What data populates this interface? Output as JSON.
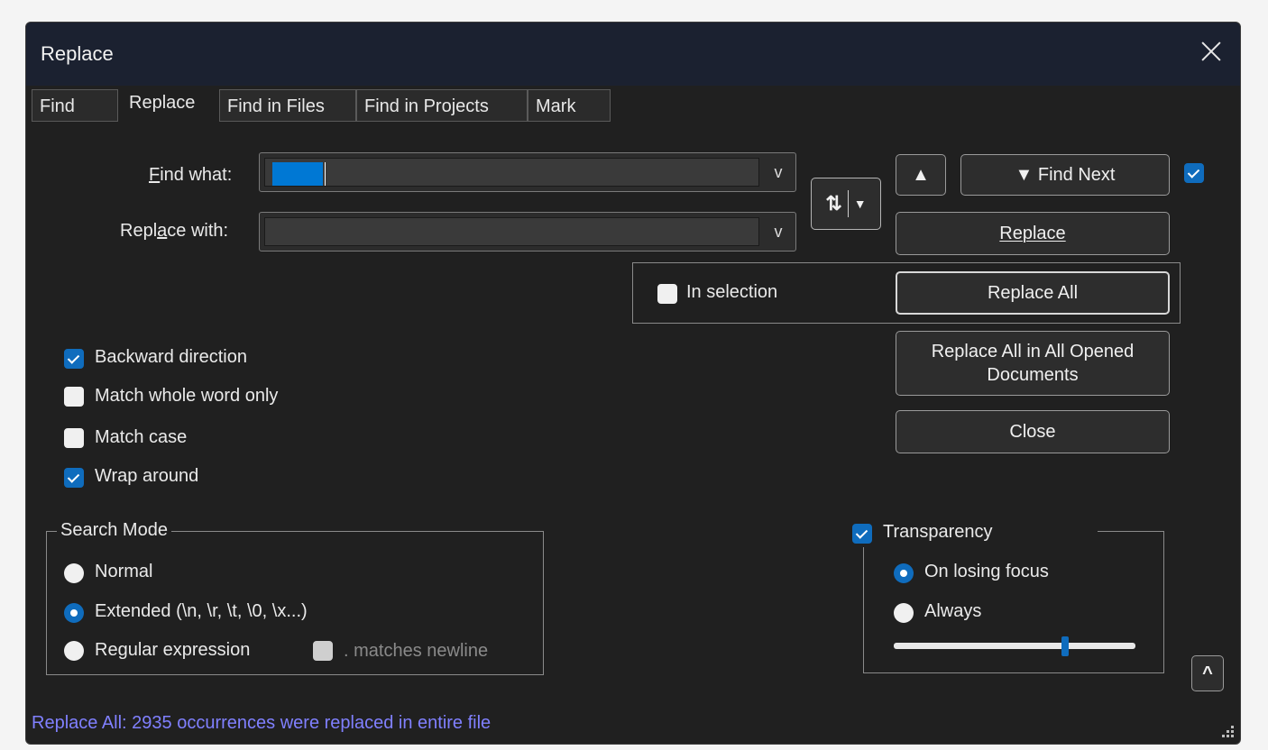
{
  "window": {
    "title": "Replace"
  },
  "tabs": [
    {
      "label": "Find"
    },
    {
      "label": "Replace"
    },
    {
      "label": "Find in Files"
    },
    {
      "label": "Find in Projects"
    },
    {
      "label": "Mark"
    }
  ],
  "active_tab": "Replace",
  "fields": {
    "find_what": {
      "label": "Find what:",
      "value": ""
    },
    "replace_with": {
      "label": "Replace with:",
      "value": ""
    }
  },
  "buttons": {
    "find_prev_arrow": "▲",
    "find_next": "▼ Find Next",
    "replace": "Replace",
    "replace_all": "Replace All",
    "replace_all_opened": "Replace All in All Opened Documents",
    "close": "Close",
    "collapse": "^",
    "swap_icon": "⇅"
  },
  "in_selection": {
    "label": "In selection",
    "checked": false
  },
  "options": [
    {
      "label": "Backward direction",
      "checked": true
    },
    {
      "label": "Match whole word only",
      "checked": false
    },
    {
      "label": "Match case",
      "checked": false
    },
    {
      "label": "Wrap around",
      "checked": true
    }
  ],
  "search_mode": {
    "title": "Search Mode",
    "options": [
      {
        "label": "Normal",
        "selected": false
      },
      {
        "label": "Extended (\\n, \\r, \\t, \\0, \\x...)",
        "selected": true
      },
      {
        "label": "Regular expression",
        "selected": false
      }
    ],
    "dot_matches_newline": {
      "label": ". matches newline",
      "checked": false
    }
  },
  "transparency": {
    "label": "Transparency",
    "checked": true,
    "options": [
      {
        "label": "On losing focus",
        "selected": true
      },
      {
        "label": "Always",
        "selected": false
      }
    ],
    "level_fraction": 0.71
  },
  "status": "Replace All: 2935 occurrences were replaced in entire file",
  "colors": {
    "accent": "#0f6cbd",
    "status_text": "#8080ff",
    "background": "#202020"
  }
}
